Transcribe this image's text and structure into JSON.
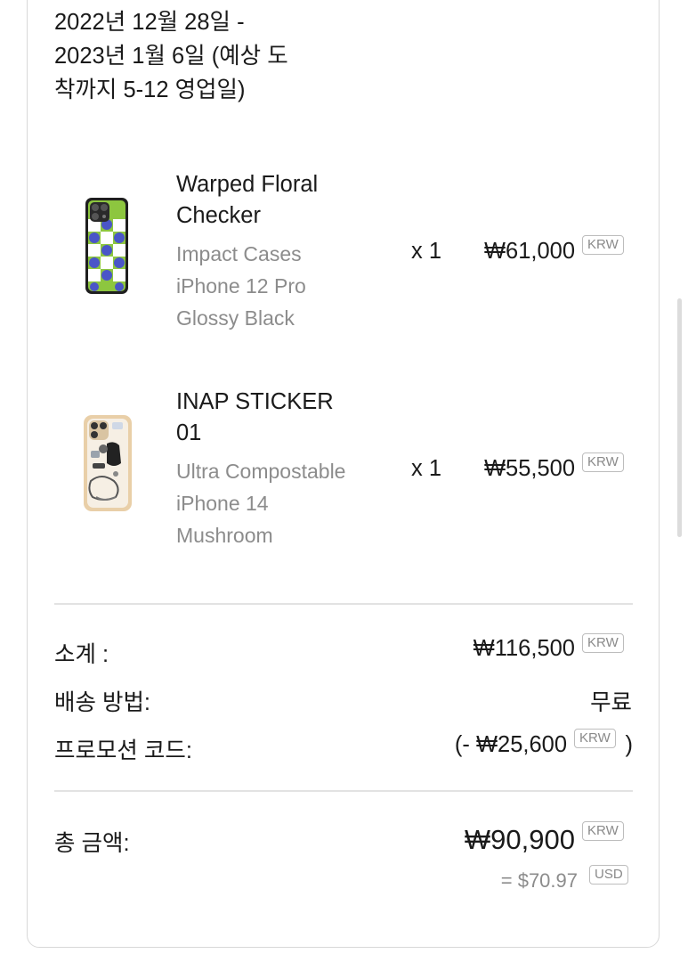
{
  "shipping_estimate": {
    "line1": "2022년 12월 28일 -",
    "line2": "2023년 1월 6일 (예상 도",
    "line3": "착까지 5-12 영업일)"
  },
  "items": [
    {
      "title_line1": "Warped Floral",
      "title_line2": "Checker",
      "case_type": "Impact Cases",
      "device": "iPhone 12 Pro",
      "finish": "Glossy Black",
      "quantity": "x 1",
      "price": "₩61,000",
      "currency": "KRW"
    },
    {
      "title_line1": "INAP STICKER",
      "title_line2": "01",
      "case_type": "Ultra Compostable",
      "device": "iPhone 14",
      "finish": "Mushroom",
      "quantity": "x 1",
      "price": "₩55,500",
      "currency": "KRW"
    }
  ],
  "summary": {
    "subtotal_label": "소계 :",
    "subtotal_value": "₩116,500",
    "subtotal_currency": "KRW",
    "shipping_label": "배송 방법:",
    "shipping_value": "무료",
    "promo_label": "프로모션 코드:",
    "promo_prefix": "(- ",
    "promo_value": "₩25,600",
    "promo_currency": "KRW",
    "promo_suffix": ")"
  },
  "total": {
    "label": "총 금액:",
    "value": "₩90,900",
    "currency": "KRW",
    "usd_value": "= $70.97",
    "usd_currency": "USD"
  },
  "colors": {
    "text": "#1a1a1a",
    "muted": "#8c8c8c",
    "divider": "#e2e2e2",
    "floral_green": "#8dc63f",
    "floral_blue": "#4a55c8"
  }
}
